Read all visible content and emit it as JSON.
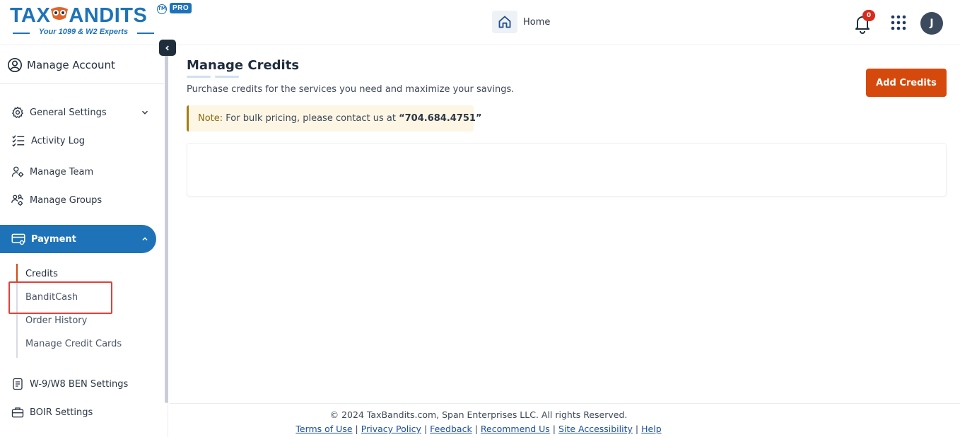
{
  "header": {
    "logo_text_left": "TAX",
    "logo_text_right": "ANDITS",
    "logo_tm": "TM",
    "logo_tagline": "Your 1099 & W2 Experts",
    "pro_badge": "PRO",
    "home_label": "Home",
    "notification_count": "0",
    "avatar_initial": "J"
  },
  "sidebar": {
    "account_label": "Manage Account",
    "items": [
      {
        "label": "General Settings",
        "icon": "gear-icon"
      },
      {
        "label": "Activity Log",
        "icon": "checklist-icon"
      },
      {
        "label": "Manage Team",
        "icon": "user-gear-icon"
      },
      {
        "label": "Manage Groups",
        "icon": "group-gear-icon"
      }
    ],
    "payment_label": "Payment",
    "payment_subitems": [
      "Credits",
      "BanditCash",
      "Order History",
      "Manage Credit Cards"
    ],
    "bottom_items": [
      {
        "label": "W-9/W8 BEN Settings",
        "icon": "document-icon"
      },
      {
        "label": "BOIR Settings",
        "icon": "briefcase-icon"
      }
    ]
  },
  "main": {
    "title": "Manage Credits",
    "subtitle": "Purchase credits for the services you need and maximize your savings.",
    "add_credits_label": "Add Credits",
    "note_label": "Note:",
    "note_text": " For bulk pricing, please contact us at ",
    "note_phone": "“704.684.4751”"
  },
  "footer": {
    "copyright": "© 2024 TaxBandits.com, Span Enterprises LLC. All rights Reserved.",
    "links": [
      "Terms of Use",
      "Privacy Policy",
      "Feedback",
      "Recommend Us",
      "Site Accessibility",
      "Help"
    ]
  },
  "colors": {
    "brand_blue": "#1e73b8",
    "accent_orange": "#d54a0c",
    "highlight_red": "#e0403a"
  }
}
